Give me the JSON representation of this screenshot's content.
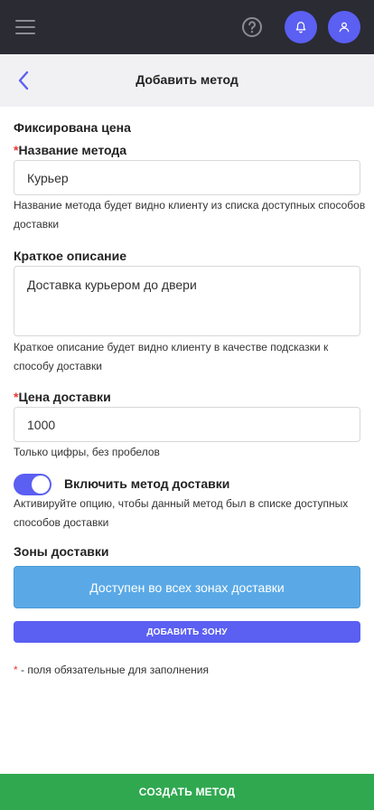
{
  "topbar": {
    "menu_icon": "hamburger-menu-icon",
    "help_icon": "question-circle-icon",
    "bell_icon": "bell-icon",
    "user_icon": "user-icon",
    "accent_color": "#5b5ff2",
    "bg_color": "#2a2b33"
  },
  "header": {
    "back_icon": "chevron-left-icon",
    "title": "Добавить метод"
  },
  "form": {
    "section_title": "Фиксирована цена",
    "required_mark": "*",
    "method_name": {
      "label": "Название метода",
      "value": "Курьер",
      "hint": "Название метода будет видно клиенту из списка доступных способов доставки"
    },
    "short_description": {
      "label": "Краткое описание",
      "value": "Доставка курьером до двери",
      "hint": "Краткое описание будет видно клиенту в качестве подсказки к способу доставки"
    },
    "price": {
      "label": "Цена доставки",
      "value": "1000",
      "hint": "Только цифры, без пробелов"
    },
    "enable_toggle": {
      "label": "Включить метод доставки",
      "checked": true,
      "hint": "Активируйте опцию, чтобы данный метод был в списке доступных способов доставки"
    },
    "zones": {
      "title": "Зоны доставки",
      "all_zones_text": "Доступен во всех зонах доставки",
      "add_zone_label": "ДОБАВИТЬ ЗОНУ"
    },
    "required_note": " - поля обязательные для заполнения"
  },
  "footer": {
    "create_label": "СОЗДАТЬ МЕТОД",
    "create_color": "#2fa84f"
  }
}
